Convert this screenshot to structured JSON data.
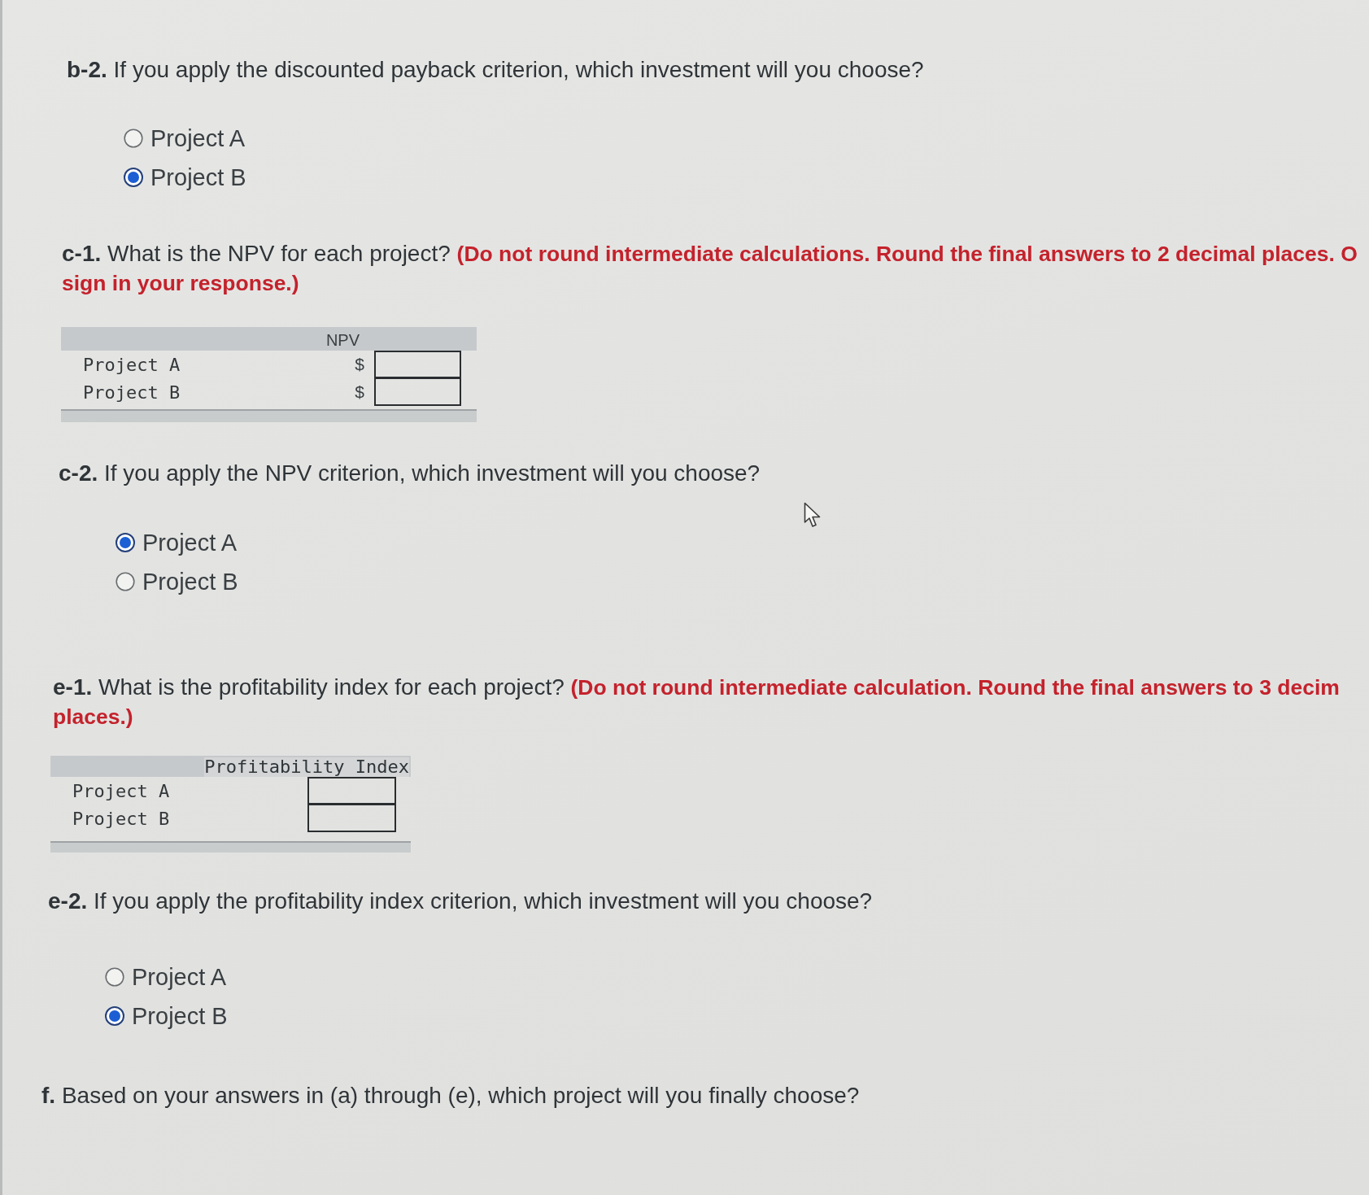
{
  "sections": [
    {
      "kind": "choice",
      "text": "**b-2.** If you apply the discounted payback criterion, which investment will you choose?",
      "options": [
        {
          "label": "Project A",
          "selected": false
        },
        {
          "label": "Project B",
          "selected": true
        }
      ]
    },
    {
      "kind": "table",
      "text": "**c-1.** What is the NPV for each project?",
      "note_lines": [
        "(Do not round intermediate calculations. Round the final answers to 2 decimal places. O",
        "sign in your response.)"
      ],
      "table": {
        "header": "NPV",
        "rows": [
          {
            "label": "Project A",
            "prefix": "$"
          },
          {
            "label": "Project B",
            "prefix": "$"
          }
        ]
      }
    },
    {
      "kind": "choice",
      "text": "**c-2.** If you apply the NPV criterion, which investment will you choose?",
      "options": [
        {
          "label": "Project A",
          "selected": true
        },
        {
          "label": "Project B",
          "selected": false
        }
      ]
    },
    {
      "kind": "table",
      "text": "**e-1.** What is the profitability index for each project?",
      "note_lines": [
        "(Do not round intermediate calculation. Round the final answers to 3 decim",
        "places.)"
      ],
      "table": {
        "header": "Profitability Index",
        "rows": [
          {
            "label": "Project A"
          },
          {
            "label": "Project B"
          }
        ]
      }
    },
    {
      "kind": "choice",
      "text": "**e-2.** If you apply the profitability index criterion, which investment will you choose?",
      "options": [
        {
          "label": "Project A",
          "selected": false
        },
        {
          "label": "Project B",
          "selected": true
        }
      ]
    },
    {
      "kind": "choice",
      "text": "**f.** Based on your answers in (a) through (e), which project will you finally choose?"
    }
  ]
}
